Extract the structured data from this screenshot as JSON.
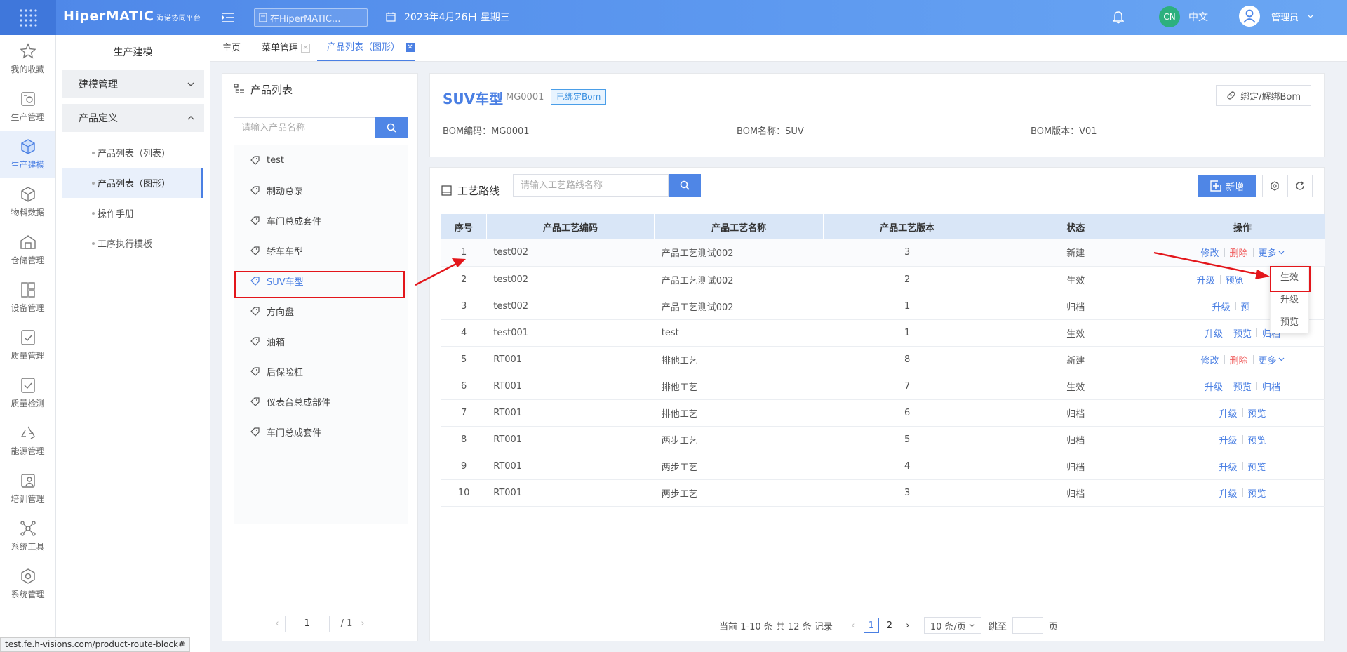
{
  "topbar": {
    "logo": "HiperMATIC",
    "logo_sub": "海诺协同平台",
    "search_placeholder": "在HiperMATIC...",
    "date": "2023年4月26日 星期三",
    "lang_badge": "CN",
    "lang": "中文",
    "user": "管理员"
  },
  "leftnav": [
    {
      "label": "我的收藏",
      "icon": "star-icon"
    },
    {
      "label": "生产管理",
      "icon": "factory-icon"
    },
    {
      "label": "生产建模",
      "icon": "cube-icon",
      "active": true
    },
    {
      "label": "物料数据",
      "icon": "box-icon"
    },
    {
      "label": "仓储管理",
      "icon": "warehouse-icon"
    },
    {
      "label": "设备管理",
      "icon": "device-icon"
    },
    {
      "label": "质量管理",
      "icon": "shield-check-icon"
    },
    {
      "label": "质量检测",
      "icon": "shield-check-icon"
    },
    {
      "label": "能源管理",
      "icon": "recycle-icon"
    },
    {
      "label": "培训管理",
      "icon": "training-icon"
    },
    {
      "label": "系统工具",
      "icon": "network-icon"
    },
    {
      "label": "系统管理",
      "icon": "hexagon-gear-icon"
    }
  ],
  "submenu": {
    "title": "生产建模",
    "group1": "建模管理",
    "group2": "产品定义",
    "items": [
      "产品列表（列表）",
      "产品列表（图形）",
      "操作手册",
      "工序执行模板"
    ]
  },
  "tabs": [
    "主页",
    "菜单管理",
    "产品列表（图形）"
  ],
  "product_list": {
    "title": "产品列表",
    "search_placeholder": "请输入产品名称",
    "items": [
      "test",
      "制动总泵",
      "车门总成套件",
      "轿车车型",
      "SUV车型",
      "方向盘",
      "油箱",
      "后保险杠",
      "仪表台总成部件",
      "车门总成套件"
    ],
    "page_current": "1",
    "page_total": "/ 1"
  },
  "bom": {
    "name": "SUV车型",
    "code": "MG0001",
    "bound_tag": "已绑定Bom",
    "bind_button": "绑定/解绑Bom",
    "bom_code": "BOM编码：MG0001",
    "bom_name": "BOM名称：SUV",
    "bom_version": "BOM版本：V01"
  },
  "route": {
    "title": "工艺路线",
    "search_placeholder": "请输入工艺路线名称",
    "add_button": "新增",
    "columns": [
      "序号",
      "产品工艺编码",
      "产品工艺名称",
      "产品工艺版本",
      "状态",
      "操作"
    ],
    "rows": [
      {
        "no": "1",
        "code": "test002",
        "name": "产品工艺测试002",
        "ver": "3",
        "status": "新建",
        "actions": [
          "修改",
          "删除",
          "更多"
        ]
      },
      {
        "no": "2",
        "code": "test002",
        "name": "产品工艺测试002",
        "ver": "2",
        "status": "生效",
        "actions": [
          "升级",
          "预览"
        ]
      },
      {
        "no": "3",
        "code": "test002",
        "name": "产品工艺测试002",
        "ver": "1",
        "status": "归档",
        "actions": [
          "升级",
          "预"
        ]
      },
      {
        "no": "4",
        "code": "test001",
        "name": "test",
        "ver": "1",
        "status": "生效",
        "actions": [
          "升级",
          "预览",
          "归档"
        ]
      },
      {
        "no": "5",
        "code": "RT001",
        "name": "排他工艺",
        "ver": "8",
        "status": "新建",
        "actions": [
          "修改",
          "删除",
          "更多"
        ]
      },
      {
        "no": "6",
        "code": "RT001",
        "name": "排他工艺",
        "ver": "7",
        "status": "生效",
        "actions": [
          "升级",
          "预览",
          "归档"
        ]
      },
      {
        "no": "7",
        "code": "RT001",
        "name": "排他工艺",
        "ver": "6",
        "status": "归档",
        "actions": [
          "升级",
          "预览"
        ]
      },
      {
        "no": "8",
        "code": "RT001",
        "name": "两步工艺",
        "ver": "5",
        "status": "归档",
        "actions": [
          "升级",
          "预览"
        ]
      },
      {
        "no": "9",
        "code": "RT001",
        "name": "两步工艺",
        "ver": "4",
        "status": "归档",
        "actions": [
          "升级",
          "预览"
        ]
      },
      {
        "no": "10",
        "code": "RT001",
        "name": "两步工艺",
        "ver": "3",
        "status": "归档",
        "actions": [
          "升级",
          "预览"
        ]
      }
    ],
    "pager": {
      "summary": "当前 1-10 条 共 12 条 记录",
      "pages": [
        "1",
        "2"
      ],
      "page_size": "10 条/页",
      "jump_label": "跳至",
      "page_unit": "页"
    }
  },
  "dropdown": [
    "生效",
    "升级",
    "预览"
  ],
  "statusbar": "test.fe.h-visions.com/product-route-block#",
  "colors": {
    "primary": "#4a7fe3",
    "danger": "#f05f5f",
    "annotation": "#e3161b"
  }
}
